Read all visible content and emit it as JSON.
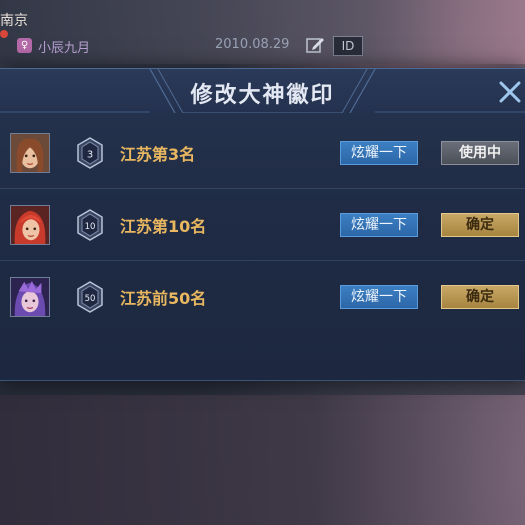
{
  "background": {
    "city": "南京",
    "player_name": "小辰九月",
    "date": "2010.08.29",
    "id_badge": "ID"
  },
  "dialog": {
    "title": "修改大神徽印",
    "rows": [
      {
        "rank_number": "3",
        "label": "江苏第3名",
        "show_off": "炫耀一下",
        "action": "使用中",
        "action_state": "in-use"
      },
      {
        "rank_number": "10",
        "label": "江苏第10名",
        "show_off": "炫耀一下",
        "action": "确定",
        "action_state": "confirm"
      },
      {
        "rank_number": "50",
        "label": "江苏前50名",
        "show_off": "炫耀一下",
        "action": "确定",
        "action_state": "confirm"
      }
    ]
  },
  "colors": {
    "accent_gold": "#e9b75f",
    "button_blue": "#2c67a8",
    "confirm_gold": "#a6853f",
    "in_use_gray": "#4c5059"
  },
  "icons": [
    "edit-icon",
    "close-icon",
    "rank-badge-icon"
  ]
}
